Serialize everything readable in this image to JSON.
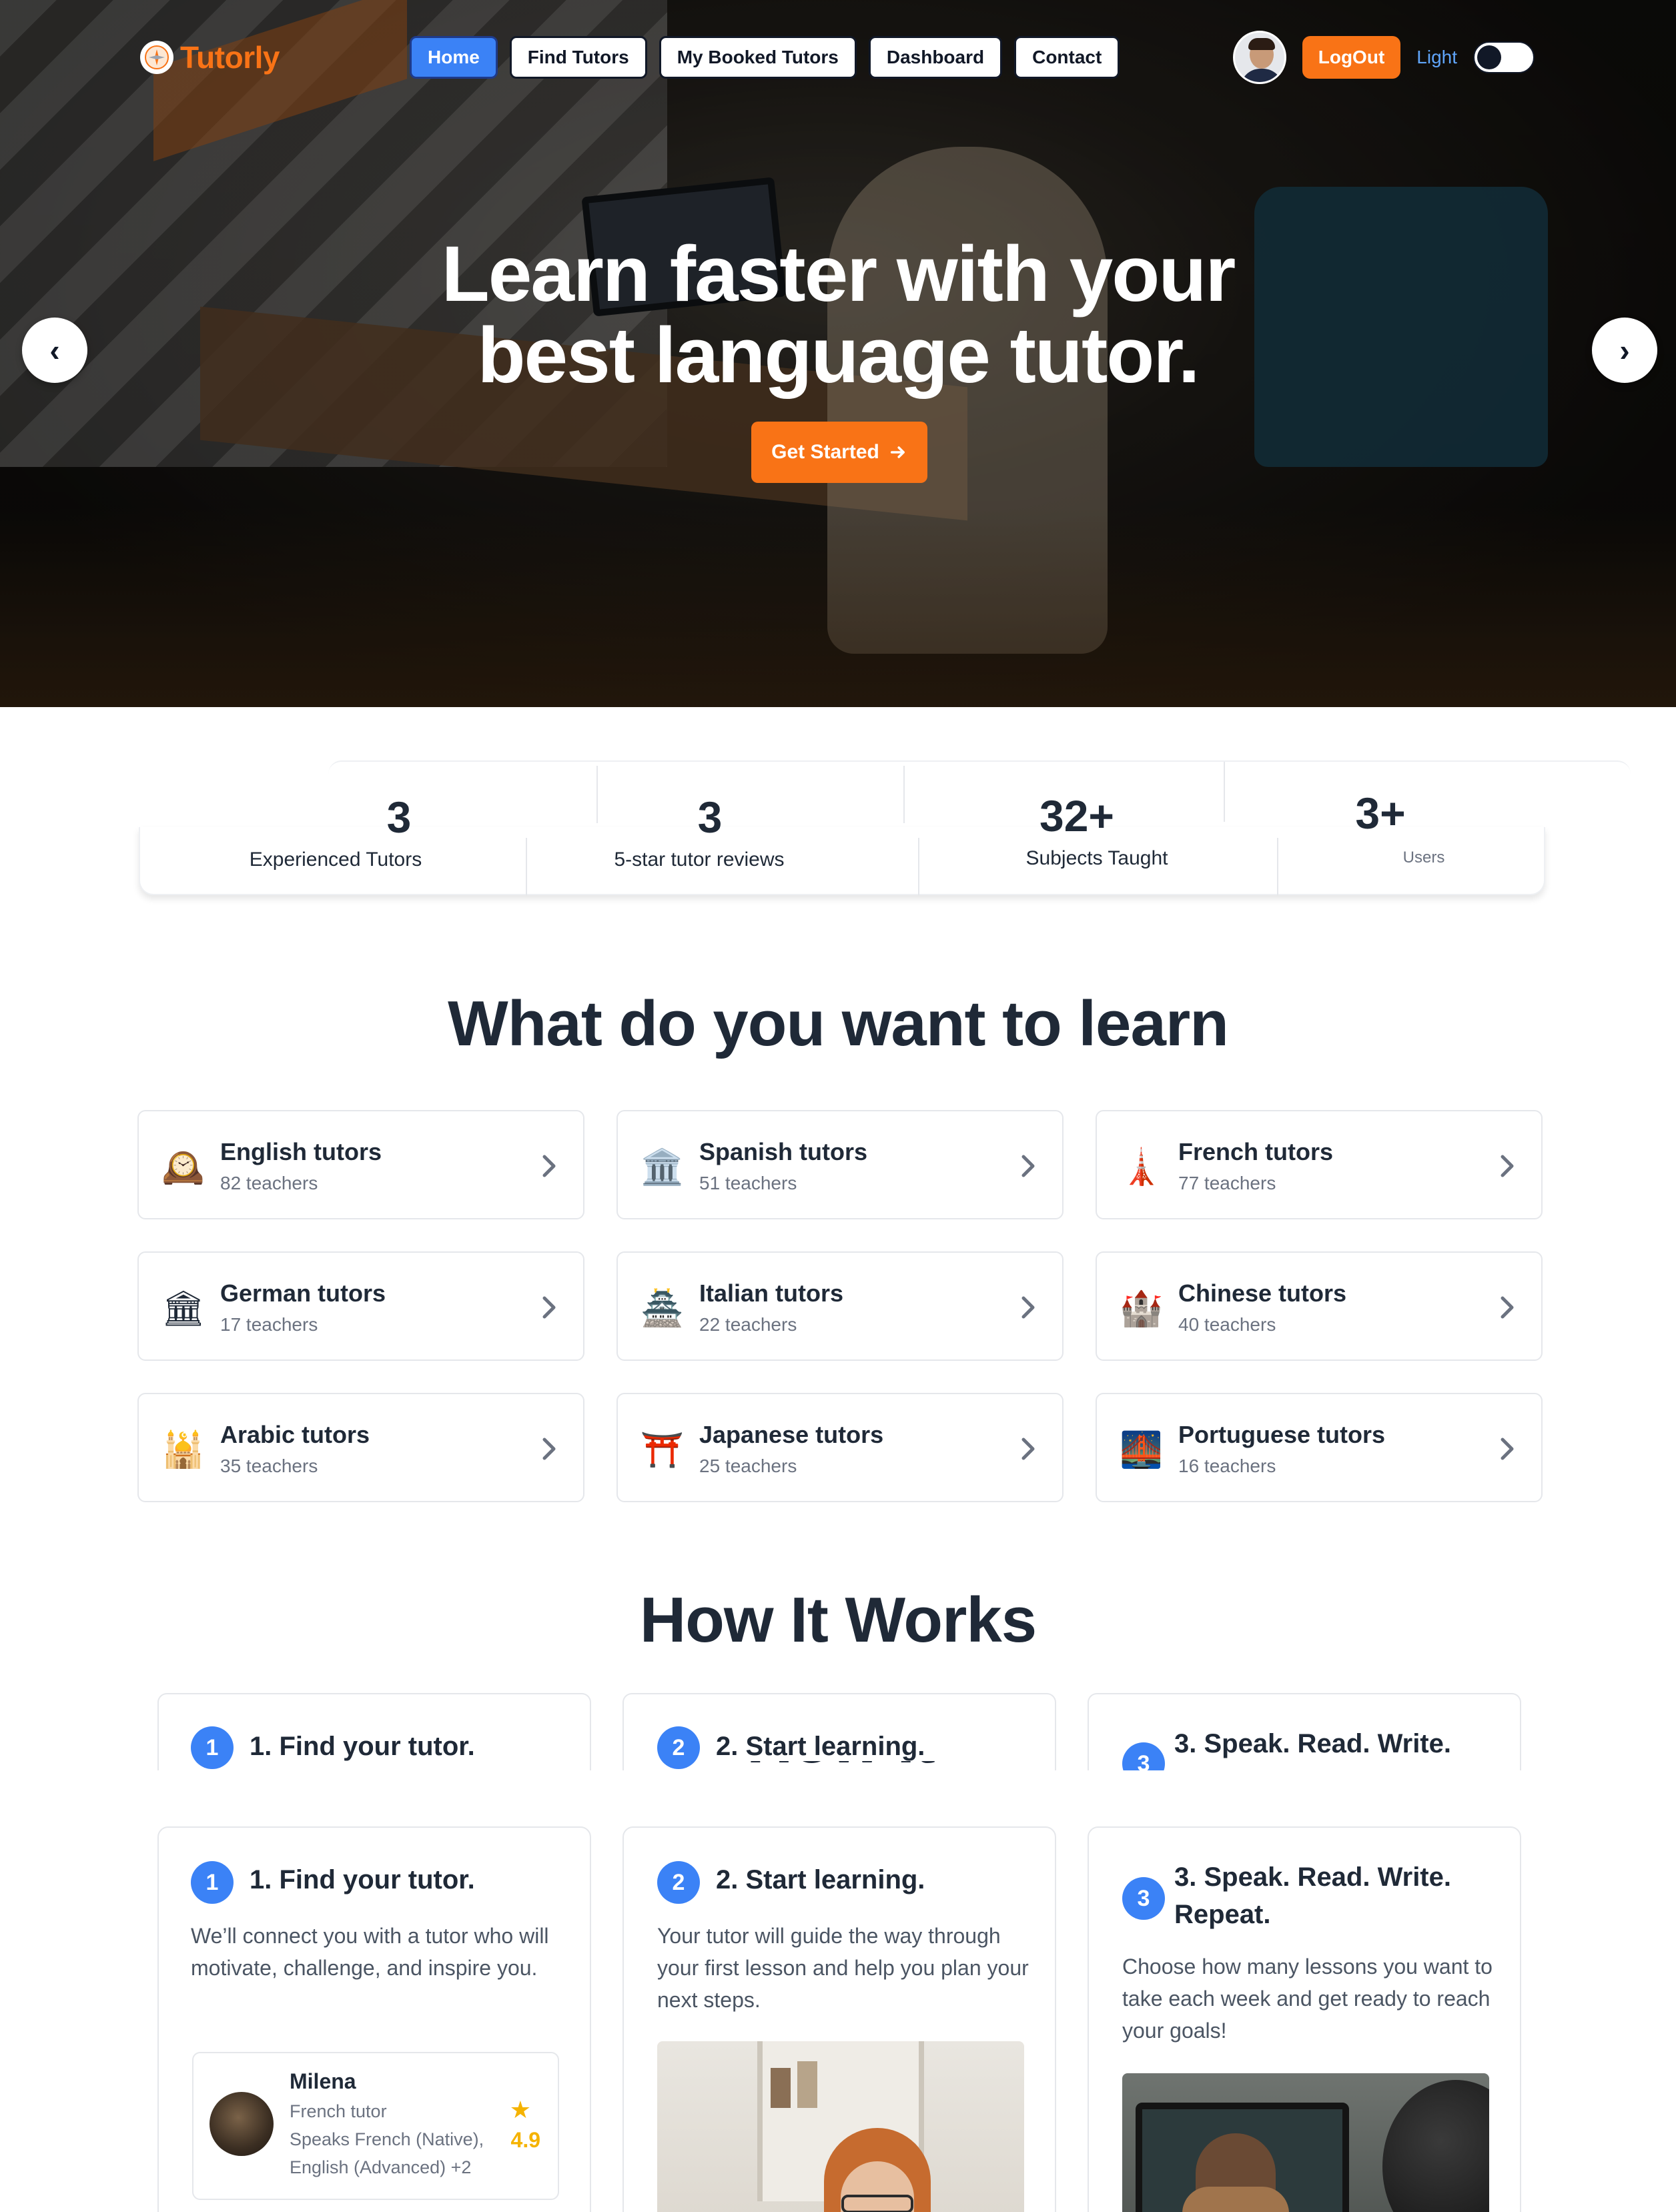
{
  "brand": {
    "name": "Tutorly",
    "accent": "#f97316",
    "primary": "#3b82f6"
  },
  "nav": {
    "links": [
      "Home",
      "Find Tutors",
      "My Booked Tutors",
      "Dashboard",
      "Contact"
    ],
    "active": "Home",
    "logout_label": "LogOut",
    "theme_label": "Light",
    "theme_dark": false
  },
  "hero": {
    "title_line1": "Learn faster with your",
    "title_line2": "best language tutor.",
    "cta_label": "Get Started",
    "prev_icon": "‹",
    "next_icon": "›"
  },
  "stats": [
    {
      "value": "3",
      "label": "Experienced Tutors"
    },
    {
      "value": "3",
      "label": "5-star tutor reviews"
    },
    {
      "value": "32+",
      "label": "Subjects Taught"
    },
    {
      "value": "3+",
      "label": "Users"
    }
  ],
  "learn": {
    "title": "What do you want to learn",
    "categories": [
      {
        "name": "English tutors",
        "count": "82 teachers",
        "icon": "🕰️"
      },
      {
        "name": "Spanish tutors",
        "count": "51 teachers",
        "icon": "🏛️"
      },
      {
        "name": "French tutors",
        "count": "77 teachers",
        "icon": "🗼"
      },
      {
        "name": "German tutors",
        "count": "17 teachers",
        "icon": "🏛"
      },
      {
        "name": "Italian tutors",
        "count": "22 teachers",
        "icon": "🏯"
      },
      {
        "name": "Chinese tutors",
        "count": "40 teachers",
        "icon": "🏰"
      },
      {
        "name": "Arabic tutors",
        "count": "35 teachers",
        "icon": "🕌"
      },
      {
        "name": "Japanese tutors",
        "count": "25 teachers",
        "icon": "⛩️"
      },
      {
        "name": "Portuguese tutors",
        "count": "16 teachers",
        "icon": "🌉"
      }
    ]
  },
  "how": {
    "title": "How It Works",
    "steps": [
      {
        "num": "1",
        "title": "1. Find your tutor.",
        "text": "We’ll connect you with a tutor who will motivate, challenge, and inspire you."
      },
      {
        "num": "2",
        "title": "2. Start learning.",
        "text": "Your tutor will guide the way through your first lesson and help you plan your next steps."
      },
      {
        "num": "3",
        "title": "3. Speak. Read. Write.",
        "title_full": "3. Speak. Read. Write. Repeat.",
        "text": "Choose how many lessons you want to take each week and get ready to reach your goals!"
      }
    ],
    "tutor_card": {
      "name": "Milena",
      "role": "French tutor",
      "speaks1": "Speaks French (Native),",
      "speaks2": "English (Advanced) +2",
      "rating": "4.9"
    }
  }
}
